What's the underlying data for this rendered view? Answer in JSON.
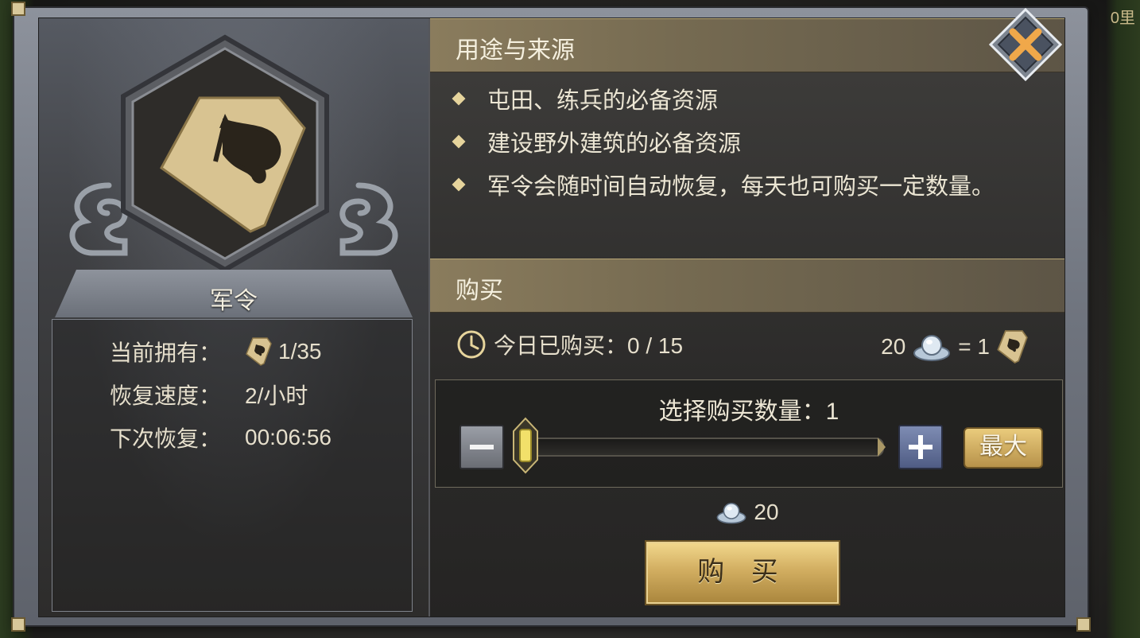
{
  "corner_hint": "0里",
  "item": {
    "name": "军令"
  },
  "stats": [
    {
      "label": "当前拥有：",
      "value": "1/35",
      "has_icon": true
    },
    {
      "label": "恢复速度：",
      "value": "2/小时"
    },
    {
      "label": "下次恢复：",
      "value": "00:06:56"
    }
  ],
  "usage": {
    "title": "用途与来源",
    "bullets": [
      "屯田、练兵的必备资源",
      "建设野外建筑的必备资源",
      "军令会随时间自动恢复，每天也可购买一定数量。"
    ]
  },
  "purchase": {
    "title": "购买",
    "today_label": "今日已购买：0 / 15",
    "rate_cost": "20",
    "rate_eq": "= 1",
    "select_label": "选择购买数量：1",
    "quantity": 1,
    "quantity_max": 15,
    "max_label": "最大",
    "total_cost": "20",
    "buy_label": "购 买"
  },
  "icons": {
    "clock": "clock-icon",
    "silver": "silver-ingot-icon",
    "token": "military-order-icon",
    "close": "close-icon"
  },
  "colors": {
    "gold": "#d2ae61",
    "accent": "#e6d49c"
  }
}
